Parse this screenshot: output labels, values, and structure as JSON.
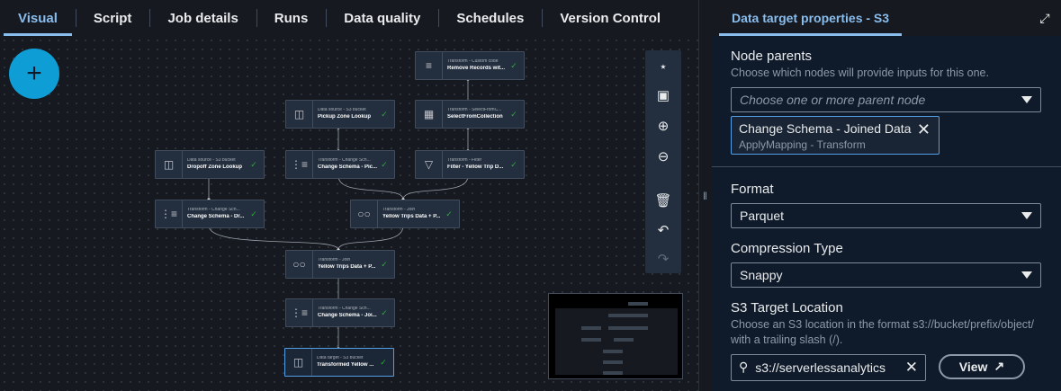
{
  "tabs": [
    "Visual",
    "Script",
    "Job details",
    "Runs",
    "Data quality",
    "Schedules",
    "Version Control"
  ],
  "fab_symbol": "+",
  "nodes": [
    {
      "type": "Transform - Custom code",
      "name": "Remove Records wit..."
    },
    {
      "type": "Data source - S3 bucket",
      "name": "Pickup Zone Lookup"
    },
    {
      "type": "Transform - SelectFromC...",
      "name": "SelectFromCollection"
    },
    {
      "type": "Data source - S3 bucket",
      "name": "Dropoff Zone Lookup"
    },
    {
      "type": "Transform - Change Sch...",
      "name": "Change Schema - Pic..."
    },
    {
      "type": "Transform - Filter",
      "name": "Filter - Yellow Trip D..."
    },
    {
      "type": "Transform - Change Sch...",
      "name": "Change Schema - Dr..."
    },
    {
      "type": "Transform - Join",
      "name": "Yellow Trips Data + P..."
    },
    {
      "type": "Transform - Join",
      "name": "Yellow Trips Data + P..."
    },
    {
      "type": "Transform - Change Sch...",
      "name": "Change Schema - Joi..."
    },
    {
      "type": "Data target - S3 bucket",
      "name": "Transformed Yellow ..."
    }
  ],
  "toolbar_icons": [
    "layout-icon",
    "fit-view-icon",
    "zoom-in-icon",
    "zoom-out-icon",
    "delete-icon",
    "undo-icon",
    "redo-icon"
  ],
  "panel": {
    "title": "Data target properties - S3",
    "node_parents": {
      "label": "Node parents",
      "description": "Choose which nodes will provide inputs for this one.",
      "placeholder": "Choose one or more parent node",
      "token_name": "Change Schema - Joined Data",
      "token_sub": "ApplyMapping - Transform"
    },
    "format": {
      "label": "Format",
      "value": "Parquet"
    },
    "compression": {
      "label": "Compression Type",
      "value": "Snappy"
    },
    "s3": {
      "label": "S3 Target Location",
      "description": "Choose an S3 location in the format s3://bucket/prefix/object/ with a trailing slash (/).",
      "value": "s3://serverlessanalytics",
      "view_label": "View"
    }
  },
  "colors": {
    "accent": "#89bdee",
    "fab": "#0f9dd6",
    "success": "#29ad32",
    "panel_bg": "#0f1b2a"
  }
}
